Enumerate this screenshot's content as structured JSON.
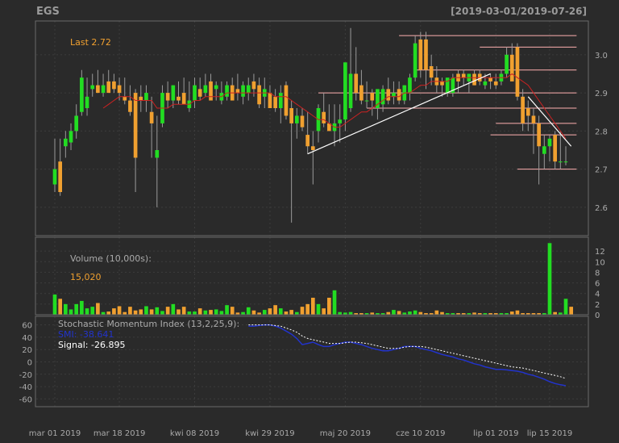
{
  "chart_data": {
    "type": "candlestick",
    "title": "EGS",
    "date_range_label": "[2019-03-01/2019-07-26]",
    "last_label": "Last 2.72",
    "colors": {
      "background": "#2a2a2a",
      "grid": "#3c3c3c",
      "up": "#22dd22",
      "down": "#f0a030",
      "text": "#aaaaaa",
      "accent": "#f0a030",
      "ma_line": "#cc2222",
      "trend_line": "#ffffff",
      "hline": "#ffb0b0",
      "smi_line": "#2233cc",
      "signal_line": "#ffffff"
    },
    "x_tick_labels": [
      "mar 01 2019",
      "mar 18 2019",
      "kwi 08 2019",
      "kwi 29 2019",
      "maj 20 2019",
      "cze 10 2019",
      "lip 01 2019",
      "lip 15 2019"
    ],
    "x_tick_index": [
      0,
      12,
      26,
      40,
      54,
      68,
      82,
      92
    ],
    "price_panel": {
      "ylim": [
        2.53,
        3.08
      ],
      "y_ticks": [
        2.6,
        2.7,
        2.8,
        2.9,
        3.0
      ],
      "y_tick_labels": [
        "2.6",
        "2.7",
        "2.8",
        "2.9",
        "3.0"
      ],
      "open": [
        2.66,
        2.72,
        2.76,
        2.77,
        2.8,
        2.85,
        2.86,
        2.91,
        2.92,
        2.9,
        2.93,
        2.93,
        2.92,
        2.89,
        2.88,
        2.9,
        2.89,
        2.88,
        2.85,
        2.73,
        2.82,
        2.9,
        2.88,
        2.89,
        2.9,
        2.86,
        2.88,
        2.91,
        2.9,
        2.93,
        2.91,
        2.88,
        2.89,
        2.92,
        2.91,
        2.89,
        2.9,
        2.93,
        2.92,
        2.89,
        2.9,
        2.89,
        2.86,
        2.92,
        2.86,
        2.82,
        2.84,
        2.79,
        2.76,
        2.8,
        2.85,
        2.82,
        2.8,
        2.82,
        2.83,
        2.86,
        2.95,
        2.92,
        2.88,
        2.9,
        2.86,
        2.87,
        2.91,
        2.89,
        2.91,
        2.88,
        2.9,
        2.94,
        3.04,
        3.04,
        2.97,
        2.94,
        2.93,
        2.9,
        2.9,
        2.95,
        2.95,
        2.93,
        2.95,
        2.95,
        2.92,
        2.94,
        2.93,
        2.93,
        2.95,
        3.0,
        3.02,
        2.89,
        2.86,
        2.84,
        2.82,
        2.74,
        2.76,
        2.79,
        2.72,
        2.72
      ],
      "high": [
        2.78,
        2.78,
        2.8,
        2.82,
        2.87,
        2.96,
        2.94,
        2.95,
        2.96,
        2.95,
        2.96,
        2.95,
        2.94,
        2.94,
        2.92,
        2.91,
        2.92,
        2.92,
        2.89,
        2.84,
        2.92,
        2.93,
        2.92,
        2.93,
        2.94,
        2.93,
        2.94,
        2.94,
        2.95,
        2.95,
        2.93,
        2.93,
        2.93,
        2.94,
        2.95,
        2.93,
        2.94,
        2.95,
        2.94,
        2.94,
        2.92,
        2.91,
        2.92,
        2.93,
        2.88,
        2.86,
        2.86,
        2.85,
        2.8,
        2.87,
        2.9,
        2.87,
        2.87,
        2.87,
        2.93,
        3.07,
        3.02,
        2.96,
        2.93,
        2.91,
        2.9,
        2.92,
        2.94,
        2.93,
        2.93,
        2.92,
        2.95,
        3.05,
        3.06,
        3.06,
        3.0,
        2.97,
        2.94,
        2.93,
        2.95,
        2.96,
        2.96,
        2.95,
        2.96,
        2.96,
        2.95,
        2.95,
        2.95,
        2.96,
        3.02,
        3.03,
        3.03,
        2.91,
        2.88,
        2.86,
        2.84,
        2.79,
        2.79,
        2.8,
        2.8,
        2.76
      ],
      "low": [
        2.64,
        2.63,
        2.73,
        2.75,
        2.78,
        2.84,
        2.84,
        2.89,
        2.9,
        2.89,
        2.9,
        2.9,
        2.88,
        2.87,
        2.84,
        2.64,
        2.85,
        2.85,
        2.73,
        2.6,
        2.81,
        2.86,
        2.86,
        2.87,
        2.87,
        2.85,
        2.86,
        2.88,
        2.89,
        2.89,
        2.88,
        2.87,
        2.88,
        2.89,
        2.88,
        2.87,
        2.88,
        2.89,
        2.86,
        2.86,
        2.86,
        2.85,
        2.82,
        2.83,
        2.56,
        2.78,
        2.8,
        2.74,
        2.66,
        2.77,
        2.81,
        2.8,
        2.76,
        2.77,
        2.8,
        2.85,
        2.88,
        2.87,
        2.86,
        2.84,
        2.83,
        2.85,
        2.87,
        2.87,
        2.87,
        2.87,
        2.88,
        2.93,
        2.94,
        2.91,
        2.92,
        2.9,
        2.89,
        2.89,
        2.89,
        2.9,
        2.92,
        2.9,
        2.92,
        2.92,
        2.91,
        2.91,
        2.91,
        2.92,
        2.94,
        2.98,
        2.88,
        2.8,
        2.8,
        2.74,
        2.66,
        2.7,
        2.72,
        2.7,
        2.7,
        2.71
      ],
      "close": [
        2.7,
        2.64,
        2.78,
        2.8,
        2.84,
        2.94,
        2.89,
        2.92,
        2.9,
        2.92,
        2.9,
        2.91,
        2.9,
        2.88,
        2.85,
        2.73,
        2.88,
        2.9,
        2.82,
        2.75,
        2.9,
        2.88,
        2.92,
        2.88,
        2.87,
        2.88,
        2.92,
        2.89,
        2.92,
        2.88,
        2.92,
        2.9,
        2.92,
        2.88,
        2.9,
        2.92,
        2.92,
        2.91,
        2.87,
        2.91,
        2.86,
        2.86,
        2.9,
        2.84,
        2.82,
        2.84,
        2.81,
        2.76,
        2.75,
        2.86,
        2.82,
        2.8,
        2.82,
        2.83,
        2.98,
        2.95,
        2.9,
        2.88,
        2.88,
        2.88,
        2.91,
        2.91,
        2.88,
        2.9,
        2.88,
        2.92,
        2.94,
        3.03,
        2.96,
        2.96,
        2.94,
        2.92,
        2.92,
        2.94,
        2.94,
        2.93,
        2.94,
        2.95,
        2.92,
        2.93,
        2.93,
        2.93,
        2.92,
        2.95,
        3.0,
        2.93,
        2.89,
        2.82,
        2.84,
        2.82,
        2.76,
        2.76,
        2.78,
        2.72,
        2.72,
        2.72
      ],
      "ma": [
        null,
        null,
        null,
        null,
        null,
        null,
        null,
        null,
        null,
        2.86,
        2.87,
        2.88,
        2.89,
        2.89,
        2.89,
        2.88,
        2.88,
        2.88,
        2.88,
        2.86,
        2.86,
        2.86,
        2.87,
        2.87,
        2.87,
        2.87,
        2.88,
        2.88,
        2.89,
        2.89,
        2.89,
        2.89,
        2.9,
        2.9,
        2.9,
        2.9,
        2.9,
        2.9,
        2.9,
        2.9,
        2.9,
        2.89,
        2.89,
        2.89,
        2.88,
        2.87,
        2.86,
        2.85,
        2.84,
        2.83,
        2.83,
        2.82,
        2.81,
        2.81,
        2.82,
        2.83,
        2.84,
        2.85,
        2.85,
        2.86,
        2.87,
        2.88,
        2.89,
        2.89,
        2.89,
        2.9,
        2.9,
        2.91,
        2.92,
        2.92,
        2.93,
        2.93,
        2.93,
        2.93,
        2.94,
        2.94,
        2.94,
        2.94,
        2.94,
        2.94,
        2.94,
        2.94,
        2.94,
        2.94,
        2.94,
        2.95,
        2.94,
        2.93,
        2.92,
        2.9,
        2.88,
        2.86,
        2.84,
        2.82,
        2.8,
        2.78
      ],
      "trend_lines": [
        {
          "from": [
            47,
            2.74
          ],
          "to": [
            81,
            2.95
          ]
        },
        {
          "from": [
            88,
            2.89
          ],
          "to": [
            96,
            2.76
          ]
        }
      ],
      "hlines": [
        {
          "value": 3.05,
          "x_from": 64,
          "x_to": 97
        },
        {
          "value": 3.02,
          "x_from": 79,
          "x_to": 97
        },
        {
          "value": 2.96,
          "x_from": 67,
          "x_to": 97
        },
        {
          "value": 2.9,
          "x_from": 49,
          "x_to": 97
        },
        {
          "value": 2.86,
          "x_from": 58,
          "x_to": 97
        },
        {
          "value": 2.82,
          "x_from": 82,
          "x_to": 97
        },
        {
          "value": 2.79,
          "x_from": 81,
          "x_to": 97
        },
        {
          "value": 2.7,
          "x_from": 86,
          "x_to": 97
        }
      ]
    },
    "volume_panel": {
      "label": "Volume (10,000s):",
      "last_value": "15,020",
      "ylim": [
        0,
        14
      ],
      "y_ticks": [
        0,
        2,
        4,
        6,
        8,
        10,
        12
      ],
      "y_tick_labels": [
        "0",
        "2",
        "4",
        "6",
        "8",
        "10",
        "12"
      ],
      "values": [
        3.8,
        3.0,
        2.0,
        1.0,
        2.0,
        2.6,
        1.2,
        1.5,
        2.2,
        0.5,
        0.6,
        1.2,
        1.6,
        0.5,
        1.5,
        0.8,
        1.0,
        1.6,
        1.0,
        1.4,
        0.7,
        1.5,
        2.0,
        1.0,
        1.5,
        0.6,
        0.6,
        1.2,
        0.8,
        0.9,
        1.0,
        0.7,
        1.8,
        1.5,
        0.4,
        0.5,
        1.4,
        0.8,
        0.4,
        0.9,
        1.2,
        1.8,
        1.2,
        0.6,
        0.9,
        0.5,
        1.5,
        2.0,
        3.2,
        2.0,
        1.2,
        3.2,
        4.6,
        0.5,
        0.4,
        0.5,
        0.3,
        0.3,
        0.3,
        0.4,
        0.3,
        0.3,
        0.5,
        0.9,
        0.7,
        0.4,
        0.6,
        0.8,
        0.5,
        0.3,
        0.3,
        0.8,
        0.5,
        0.3,
        0.3,
        0.3,
        0.3,
        0.3,
        0.4,
        0.3,
        0.3,
        0.3,
        0.3,
        0.3,
        0.3,
        0.6,
        0.8,
        0.3,
        0.3,
        0.3,
        0.3,
        0.3,
        13.5,
        0.5,
        0.4,
        3.0,
        1.5
      ]
    },
    "smi_panel": {
      "label": "Stochastic Momentum Index (13,2,25,9):",
      "smi_label": "SMI: -38.641",
      "signal_label": "Signal: -26.895",
      "ylim": [
        -70,
        70
      ],
      "y_ticks": [
        -60,
        -40,
        -20,
        0,
        20,
        40,
        60
      ],
      "y_tick_labels": [
        "-60",
        "-40",
        "-20",
        "0",
        "20",
        "40",
        "60"
      ],
      "smi": [
        null,
        null,
        null,
        null,
        null,
        null,
        null,
        null,
        null,
        null,
        null,
        null,
        null,
        null,
        null,
        null,
        null,
        null,
        null,
        null,
        null,
        null,
        null,
        null,
        null,
        null,
        null,
        null,
        null,
        null,
        null,
        null,
        null,
        null,
        null,
        null,
        58,
        58,
        59,
        60,
        60,
        58,
        55,
        50,
        45,
        38,
        28,
        30,
        32,
        28,
        25,
        25,
        28,
        30,
        32,
        32,
        30,
        28,
        25,
        22,
        20,
        18,
        18,
        20,
        22,
        25,
        25,
        25,
        22,
        20,
        18,
        15,
        12,
        10,
        8,
        5,
        3,
        0,
        -3,
        -5,
        -8,
        -10,
        -12,
        -12,
        -13,
        -14,
        -15,
        -17,
        -20,
        -22,
        -25,
        -28,
        -32,
        -35,
        -37,
        -38.6
      ],
      "signal": [
        null,
        null,
        null,
        null,
        null,
        null,
        null,
        null,
        null,
        null,
        null,
        null,
        null,
        null,
        null,
        null,
        null,
        null,
        null,
        null,
        null,
        null,
        null,
        null,
        null,
        null,
        null,
        null,
        null,
        null,
        null,
        null,
        null,
        null,
        null,
        null,
        60,
        60,
        60,
        60,
        60,
        59,
        58,
        55,
        52,
        48,
        42,
        38,
        36,
        34,
        32,
        30,
        30,
        30,
        31,
        32,
        32,
        31,
        30,
        28,
        26,
        24,
        22,
        22,
        22,
        24,
        25,
        25,
        25,
        24,
        22,
        20,
        18,
        16,
        14,
        12,
        10,
        8,
        6,
        4,
        2,
        0,
        -2,
        -4,
        -6,
        -8,
        -9,
        -10,
        -12,
        -14,
        -16,
        -18,
        -20,
        -22,
        -24,
        -26.9
      ]
    }
  }
}
